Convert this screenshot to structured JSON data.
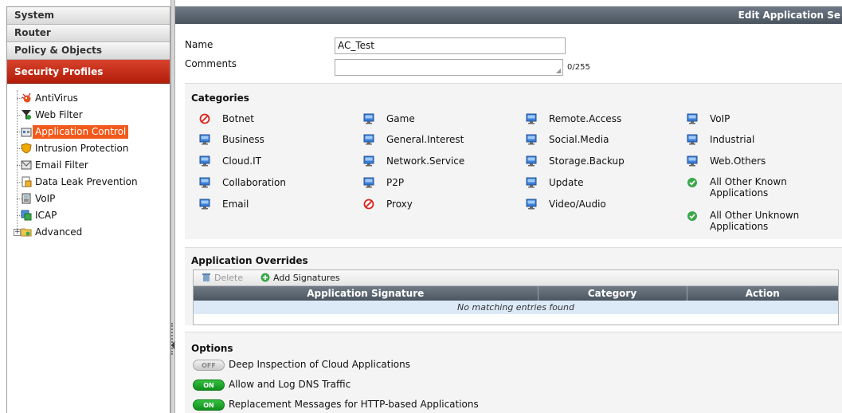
{
  "nav": {
    "sections": [
      "System",
      "Router",
      "Policy & Objects",
      "Security Profiles"
    ],
    "tree": [
      {
        "label": "AntiVirus",
        "icon": "antivirus-icon"
      },
      {
        "label": "Web Filter",
        "icon": "web-filter-icon"
      },
      {
        "label": "Application Control",
        "icon": "application-control-icon"
      },
      {
        "label": "Intrusion Protection",
        "icon": "intrusion-protection-icon"
      },
      {
        "label": "Email Filter",
        "icon": "email-filter-icon"
      },
      {
        "label": "Data Leak Prevention",
        "icon": "data-leak-prevention-icon"
      },
      {
        "label": "VoIP",
        "icon": "voip-icon"
      },
      {
        "label": "ICAP",
        "icon": "icap-icon"
      },
      {
        "label": "Advanced",
        "icon": "advanced-folder-icon"
      }
    ],
    "expander": "+"
  },
  "header": {
    "title": "Edit Application Se"
  },
  "form": {
    "name_label": "Name",
    "name_value": "AC_Test",
    "comments_label": "Comments",
    "comments_count": "0/255"
  },
  "categories": {
    "title": "Categories",
    "items": [
      {
        "label": "Botnet",
        "icon": "block-icon"
      },
      {
        "label": "Business",
        "icon": "monitor-icon"
      },
      {
        "label": "Cloud.IT",
        "icon": "monitor-icon"
      },
      {
        "label": "Collaboration",
        "icon": "monitor-icon"
      },
      {
        "label": "Email",
        "icon": "monitor-icon"
      },
      {
        "label": "Game",
        "icon": "monitor-icon"
      },
      {
        "label": "General.Interest",
        "icon": "monitor-icon"
      },
      {
        "label": "Network.Service",
        "icon": "monitor-icon"
      },
      {
        "label": "P2P",
        "icon": "monitor-icon"
      },
      {
        "label": "Proxy",
        "icon": "block-icon"
      },
      {
        "label": "Remote.Access",
        "icon": "monitor-icon"
      },
      {
        "label": "Social.Media",
        "icon": "monitor-icon"
      },
      {
        "label": "Storage.Backup",
        "icon": "monitor-icon"
      },
      {
        "label": "Update",
        "icon": "monitor-icon"
      },
      {
        "label": "Video/Audio",
        "icon": "monitor-icon"
      },
      {
        "label": "VoIP",
        "icon": "monitor-icon"
      },
      {
        "label": "Industrial",
        "icon": "monitor-icon"
      },
      {
        "label": "Web.Others",
        "icon": "monitor-icon"
      },
      {
        "label_line1": "All Other Known",
        "label_line2": "Applications",
        "icon": "check-circle-icon"
      },
      {
        "label_line1": "All Other Unknown",
        "label_line2": "Applications",
        "icon": "check-circle-icon"
      }
    ]
  },
  "overrides": {
    "title": "Application Overrides",
    "delete_label": "Delete",
    "add_label": "Add Signatures",
    "columns": [
      "Application Signature",
      "Category",
      "Action"
    ],
    "empty_message": "No matching entries found"
  },
  "options": {
    "title": "Options",
    "items": [
      {
        "state": "OFF",
        "label": "Deep Inspection of Cloud Applications"
      },
      {
        "state": "ON",
        "label": "Allow and Log DNS Traffic"
      },
      {
        "state": "ON",
        "label": "Replacement Messages for HTTP-based Applications"
      }
    ]
  },
  "colors": {
    "active_section": "#c62a14",
    "selected_item": "#f25a1c",
    "title_bar": "#5a646f",
    "toggle_on": "#1fa52c",
    "table_empty_row": "#dceaf8"
  }
}
